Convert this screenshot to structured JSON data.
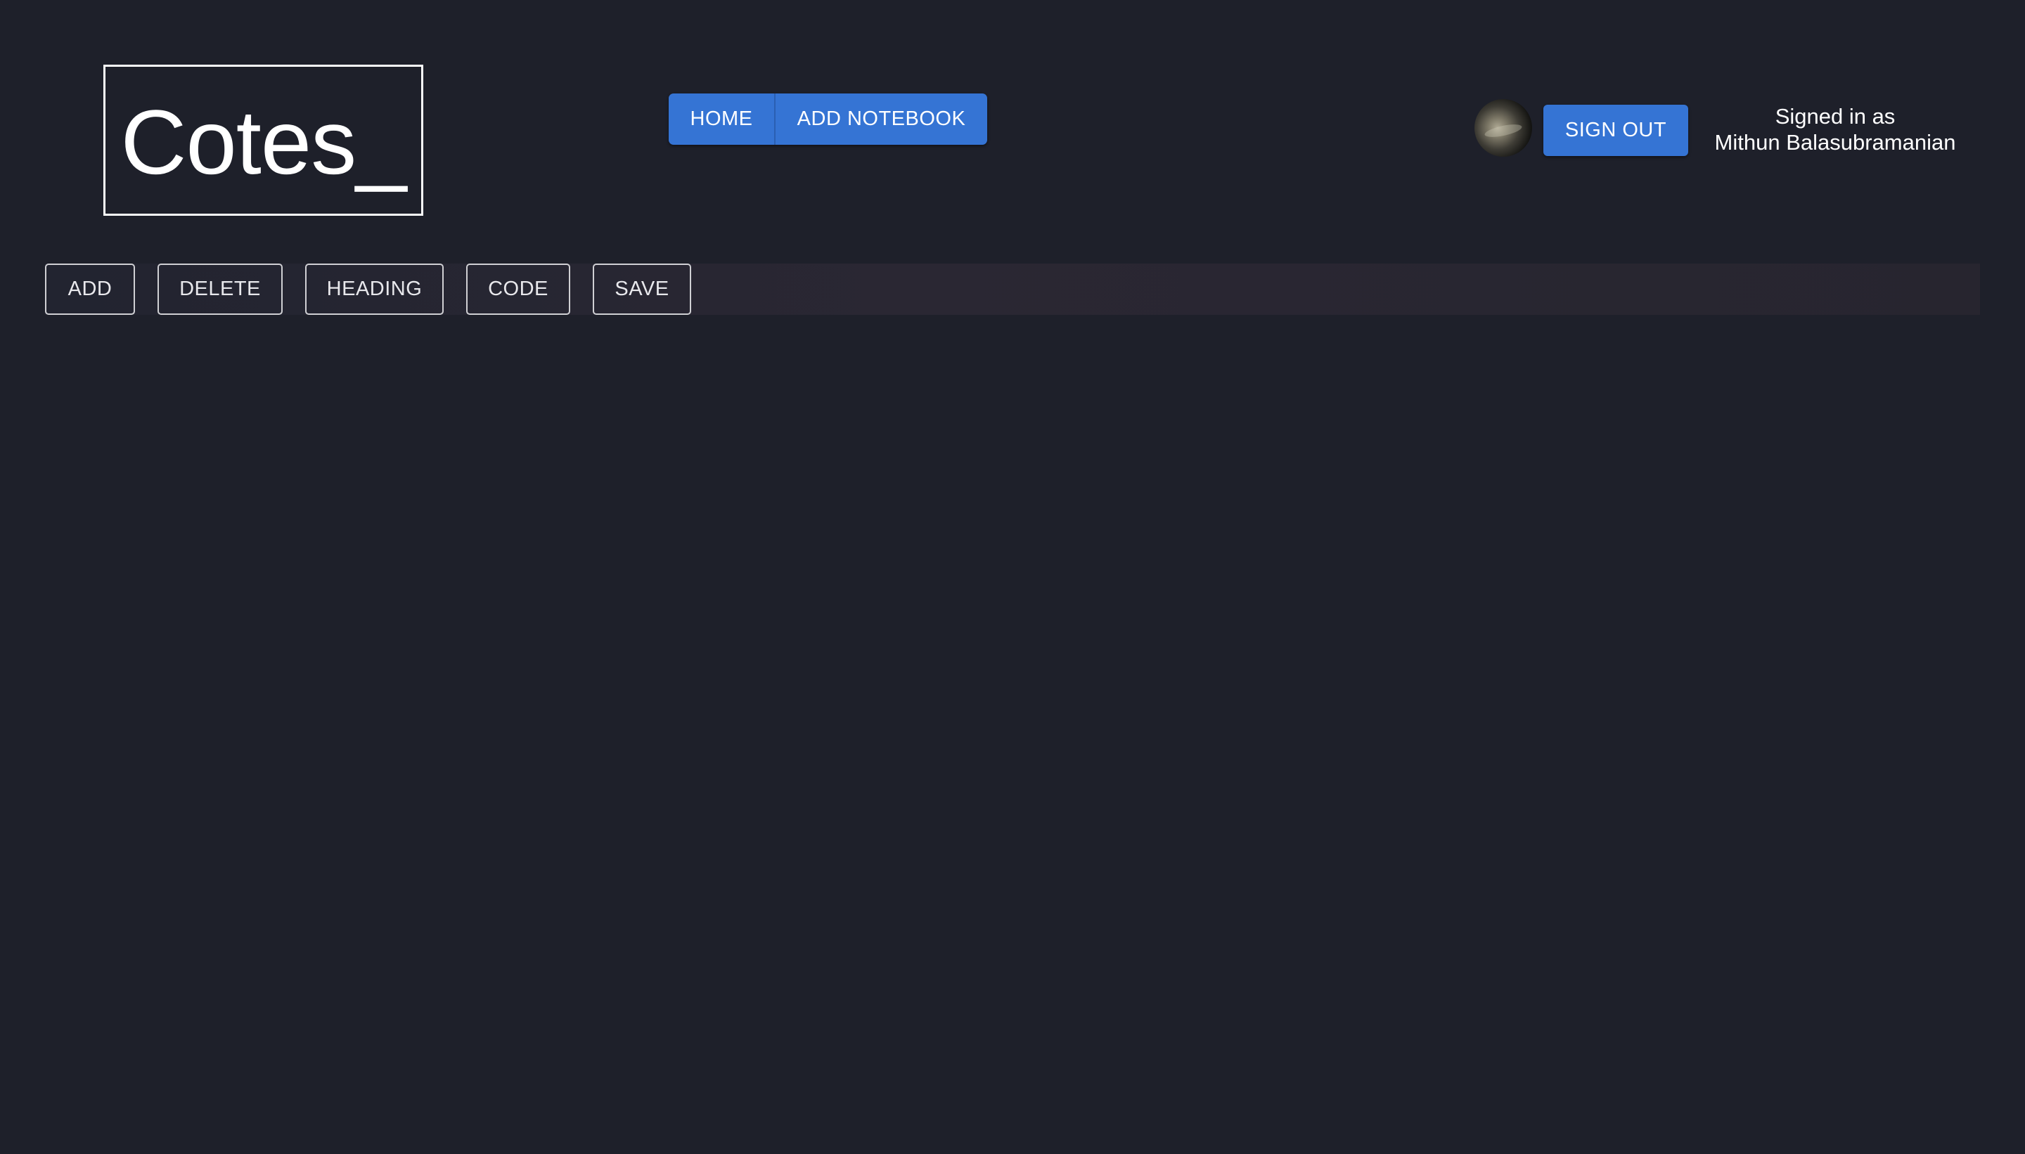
{
  "header": {
    "logo_text": "Cotes_",
    "nav": {
      "home_label": "HOME",
      "add_notebook_label": "ADD NOTEBOOK"
    },
    "user": {
      "sign_out_label": "SIGN OUT",
      "signed_in_prefix": "Signed in as",
      "user_name": "Mithun Balasubramanian"
    }
  },
  "toolbar": {
    "add_label": "ADD",
    "delete_label": "DELETE",
    "heading_label": "HEADING",
    "code_label": "CODE",
    "save_label": "SAVE"
  },
  "colors": {
    "background": "#1e202a",
    "accent": "#3574d4",
    "text": "#ffffff"
  },
  "icons": {
    "avatar": "user-avatar"
  }
}
